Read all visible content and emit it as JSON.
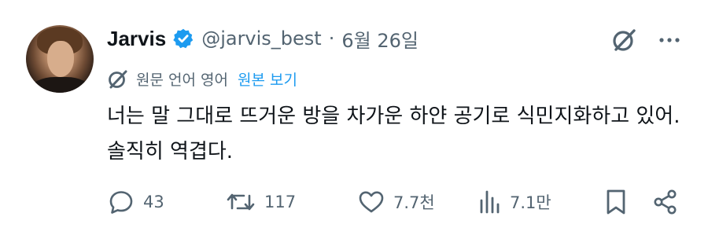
{
  "tweet": {
    "display_name": "Jarvis",
    "handle": "@jarvis_best",
    "separator": "·",
    "date": "6월 26일",
    "translation": {
      "label": "원문 언어 영어",
      "show_original": "원본 보기"
    },
    "text": "너는 말 그대로 뜨거운 방을 차가운 하얀 공기로 식민지화하고 있어. 솔직히 역겹다.",
    "metrics": {
      "replies": "43",
      "retweets": "117",
      "likes": "7.7천",
      "views": "7.1만"
    },
    "colors": {
      "accent": "#1d9bf0",
      "secondary_text": "#536471",
      "primary_text": "#0f1419"
    },
    "icons": [
      "verified-badge-icon",
      "grok-icon",
      "more-icon",
      "translate-icon",
      "reply-icon",
      "retweet-icon",
      "like-icon",
      "views-icon",
      "bookmark-icon",
      "share-icon"
    ]
  }
}
